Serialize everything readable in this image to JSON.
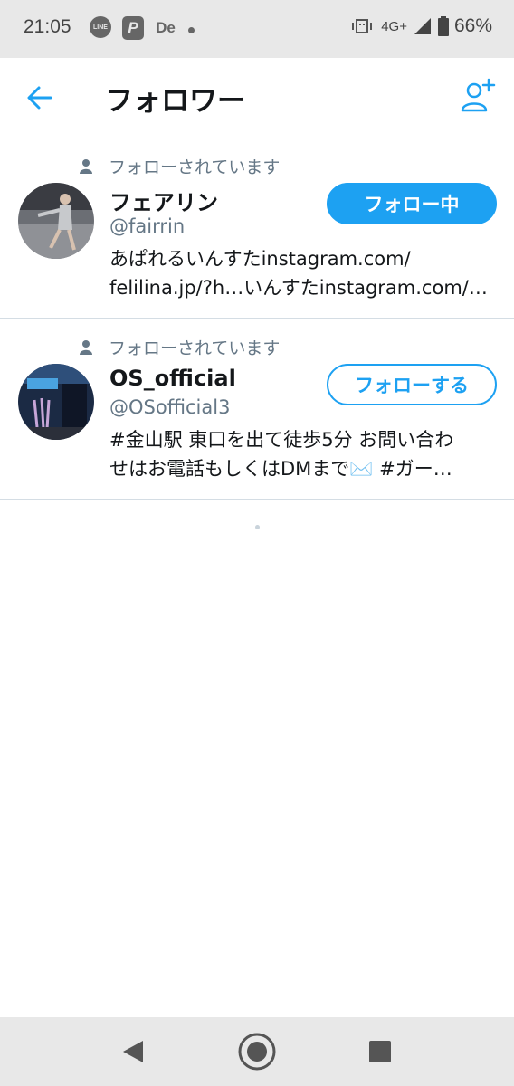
{
  "status_bar": {
    "time": "21:05",
    "notification_icons": [
      "line-icon",
      "paypay-icon",
      "de-icon",
      "dot-icon"
    ],
    "line_label": "LINE",
    "pay_label": "P",
    "de_label": "De",
    "network": "4G+",
    "battery": "66%"
  },
  "header": {
    "title": "フォロワー",
    "back_icon": "arrow-left-icon",
    "add_icon": "add-user-icon",
    "accent": "#1da1f2"
  },
  "followers": [
    {
      "follows_you": "フォローされています",
      "name": "フェアリン",
      "handle": "@fairrin",
      "bio_line1": "あぱれるいんすたinstagram.com/",
      "bio_line2": "felilina.jp/?h…いんすたinstagram.com/…",
      "button": "フォロー中",
      "following": true
    },
    {
      "follows_you": "フォローされています",
      "name": "OS_official",
      "handle": "@OSofficial3",
      "bio_line1": "#金山駅 東口を出て徒歩5分 お問い合わ",
      "bio_line2": "せはお電話もしくはDMまで✉️  #ガー…",
      "button": "フォローする",
      "following": false
    }
  ],
  "colors": {
    "primary_text": "#14171a",
    "secondary_text": "#657786",
    "divider": "#d4dde4"
  }
}
